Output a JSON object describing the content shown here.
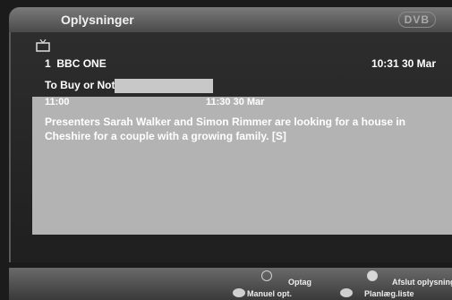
{
  "header": {
    "title": "Oplysninger",
    "logo": "DVB"
  },
  "channel": {
    "number": "1",
    "name": "BBC ONE",
    "clock": "10:31 30 Mar"
  },
  "programme": {
    "title": "To Buy or Not to buy",
    "start": "11:00",
    "end": "11:30 30 Mar",
    "description": "Presenters Sarah Walker and Simon Rimmer are looking for a house in Cheshire for a couple with a growing family. [S]"
  },
  "footer": {
    "record": "Optag",
    "info_exit": "Afslut oplysninger",
    "manual": "Manuel opt.",
    "schedule": "Planlæg.liste"
  },
  "colors": {
    "panel": "#2f2f2f",
    "description_bg": "#b3b3b3",
    "titlebar": "#5f5f5f"
  }
}
